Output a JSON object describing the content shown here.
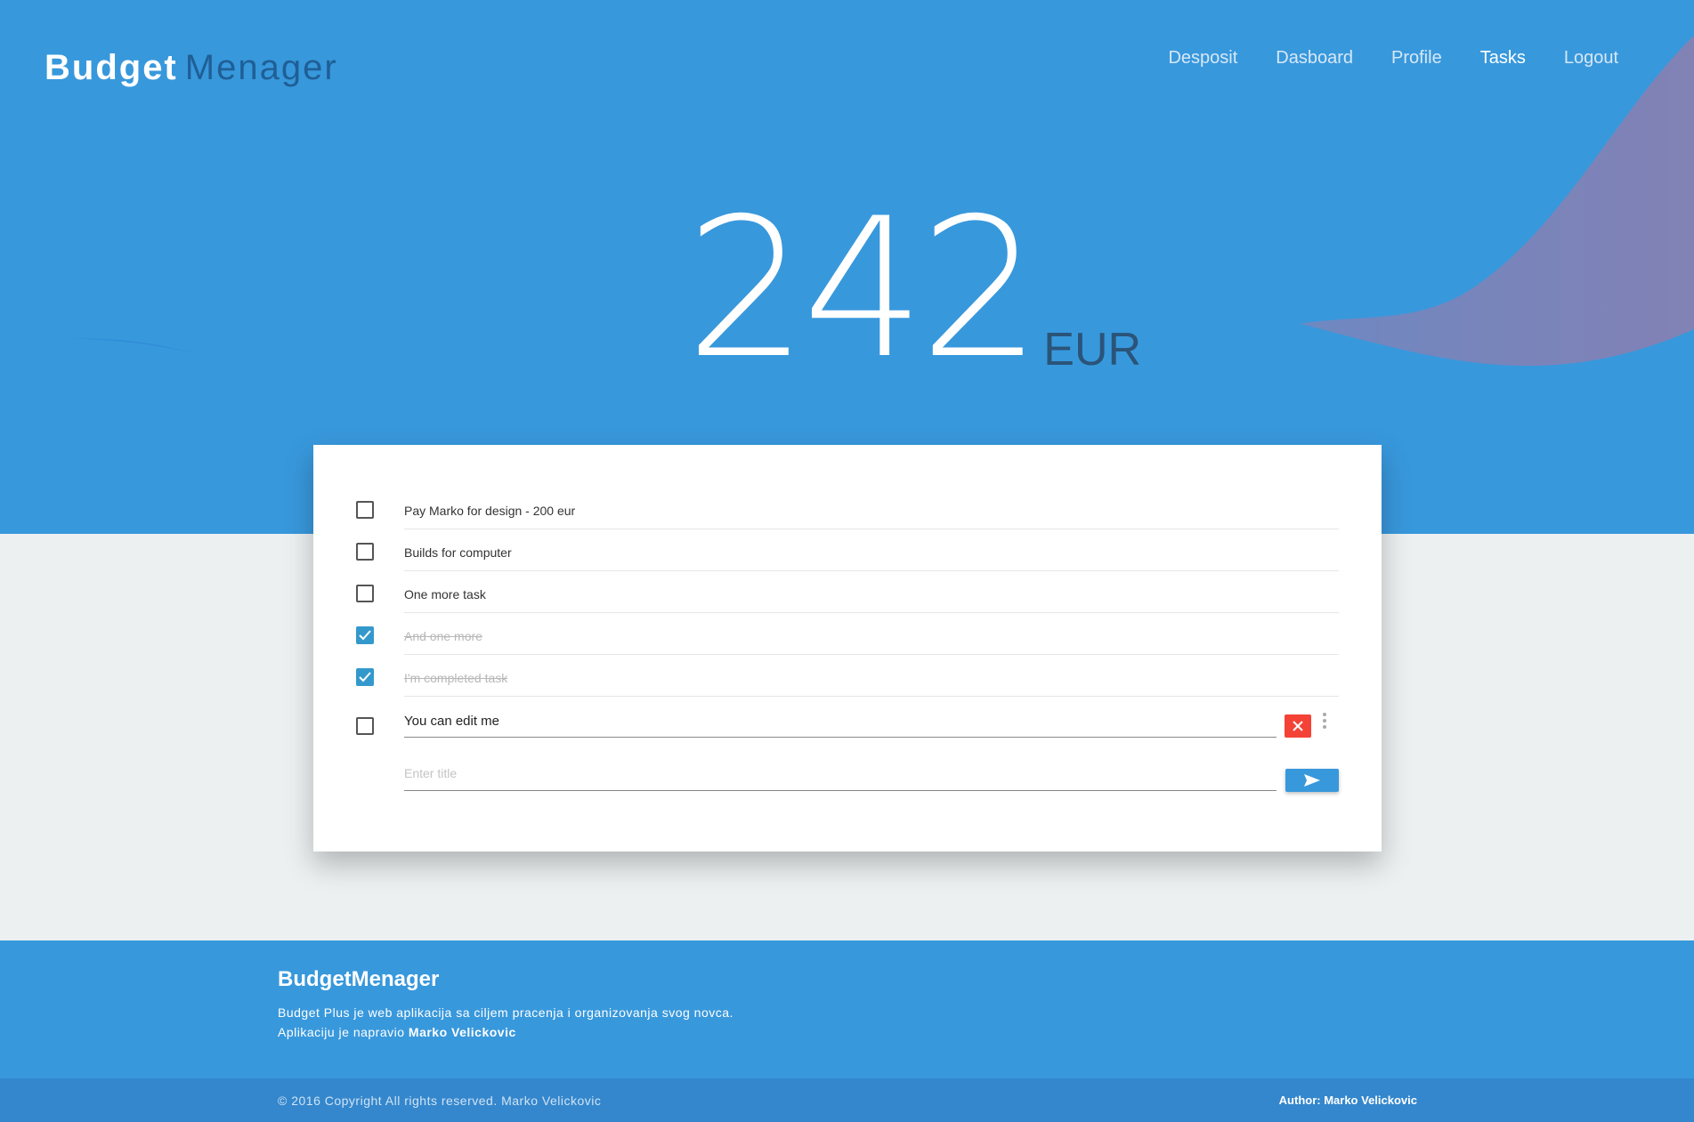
{
  "brand": {
    "part1": "Budget",
    "part2": "Menager"
  },
  "nav": {
    "items": [
      {
        "label": "Desposit"
      },
      {
        "label": "Dasboard"
      },
      {
        "label": "Profile"
      },
      {
        "label": "Tasks"
      },
      {
        "label": "Logout"
      }
    ],
    "active": "Tasks"
  },
  "balance": {
    "amount": "242",
    "currency": "EUR"
  },
  "tasks": [
    {
      "title": "Pay Marko for design - 200 eur",
      "completed": false
    },
    {
      "title": "Builds for computer",
      "completed": false
    },
    {
      "title": "One more task",
      "completed": false
    },
    {
      "title": "And one more",
      "completed": true
    },
    {
      "title": "I'm completed task",
      "completed": true
    }
  ],
  "editing_task": {
    "value": "You can edit me",
    "completed": false
  },
  "new_task": {
    "placeholder": "Enter title",
    "value": ""
  },
  "icons": {
    "checkbox_checked": "check-icon",
    "delete": "close-icon",
    "more": "more-vertical-icon",
    "send": "send-icon"
  },
  "footer": {
    "title": "BudgetMenager",
    "line1": "Budget Plus je web aplikacija sa ciljem pracenja i organizovanja svog novca.",
    "line2_prefix": "Aplikaciju je napravio ",
    "line2_author": "Marko Velickovic"
  },
  "bottom_bar": {
    "copyright": "© 2016 Copyright All rights reserved. Marko Velickovic",
    "author": "Author: Marko Velickovic"
  },
  "colors": {
    "primary": "#3898dc",
    "brand_secondary": "#1f5f96",
    "delete": "#f44336",
    "checked": "#3399cc",
    "background": "#ecf0f1"
  }
}
